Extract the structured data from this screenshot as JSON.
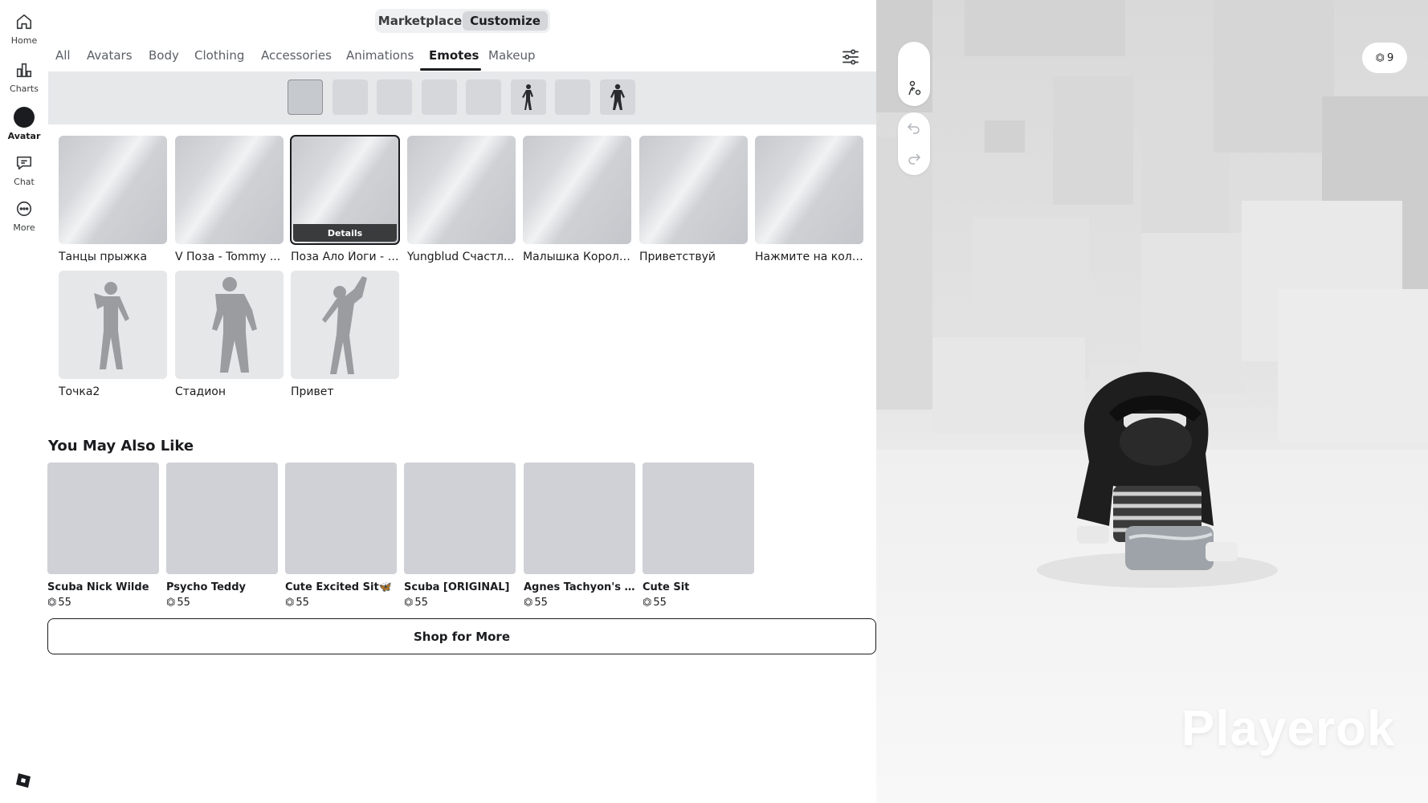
{
  "nav": [
    {
      "id": "home",
      "label": "Home",
      "icon": "home-icon"
    },
    {
      "id": "charts",
      "label": "Charts",
      "icon": "charts-icon"
    },
    {
      "id": "avatar",
      "label": "Avatar",
      "icon": "avatar-icon"
    },
    {
      "id": "chat",
      "label": "Chat",
      "icon": "chat-icon"
    },
    {
      "id": "more",
      "label": "More",
      "icon": "more-icon"
    }
  ],
  "top_switch": {
    "marketplace": "Marketplace",
    "customize": "Customize",
    "active": "customize"
  },
  "tabs": [
    "All",
    "Avatars",
    "Body",
    "Clothing",
    "Accessories",
    "Animations",
    "Emotes",
    "Makeup"
  ],
  "active_tab": "Emotes",
  "emotes": [
    {
      "name": "Танцы прыжка"
    },
    {
      "name": "V Поза - Tommy ..."
    },
    {
      "name": "Поза Ало Йоги - П...",
      "selected": true,
      "details": "Details"
    },
    {
      "name": "Yungblud Счастл..."
    },
    {
      "name": "Малышка Короле..."
    },
    {
      "name": "Приветствуй"
    },
    {
      "name": "Нажмите на колени"
    },
    {
      "name": "Точка2"
    },
    {
      "name": "Стадион"
    },
    {
      "name": "Привет"
    }
  ],
  "you_may_also_like": {
    "title": "You May Also Like",
    "items": [
      {
        "name": "Scuba Nick Wilde",
        "price": "55"
      },
      {
        "name": "Psycho Teddy",
        "price": "55"
      },
      {
        "name": "Cute Excited Sit🦋",
        "price": "55"
      },
      {
        "name": "Scuba [ORIGINAL]",
        "price": "55"
      },
      {
        "name": "Agnes Tachyon's Lo...",
        "price": "55"
      },
      {
        "name": "Cute Sit",
        "price": "55"
      }
    ],
    "shop_more": "Shop for More"
  },
  "viewport": {
    "robux": "9",
    "player_name": "Playerok"
  }
}
